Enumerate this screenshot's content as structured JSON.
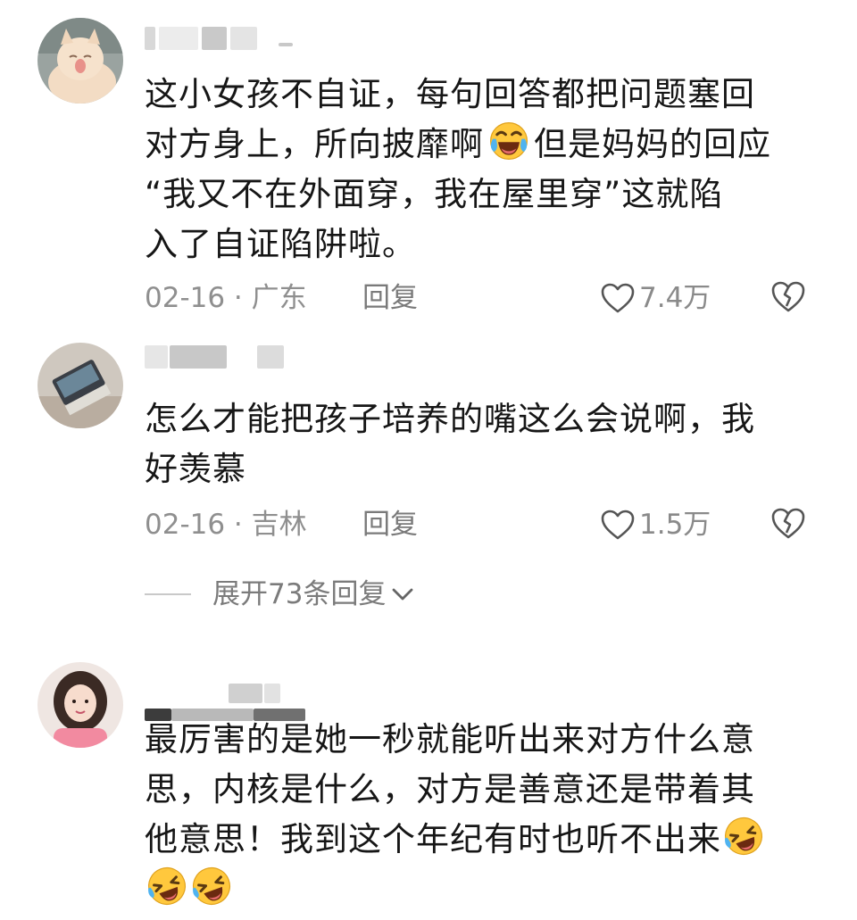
{
  "comments": [
    {
      "text_lines": [
        "这小女孩不自证，每句回答都把问题塞回",
        "对方身上，所向披靡啊",
        "但是妈妈的回应",
        "“我又不在外面穿，我在屋里穿”这就陷",
        "入了自证陷阱啦。"
      ],
      "date": "02-16",
      "region": "广东",
      "date_region": "02-16 · 广东",
      "reply_label": "回复",
      "likes": "7.4万"
    },
    {
      "text_lines": [
        "怎么才能把孩子培养的嘴这么会说啊，我",
        "好羡慕"
      ],
      "date_region": "02-16 · 吉林",
      "reply_label": "回复",
      "likes": "1.5万"
    },
    {
      "text_lines": [
        "最厉害的是她一秒就能听出来对方什么意",
        "思，内核是什么，对方是善意还是带着其",
        "他意思！我到这个年纪有时也听不出来"
      ]
    }
  ],
  "expand_replies": "展开73条回复",
  "icons": {
    "like": "heart-outline-icon",
    "dislike": "broken-heart-icon",
    "expand": "chevron-down-icon",
    "emoji_tears": "tears-of-joy-emoji",
    "emoji_rofl": "rolling-laughing-emoji"
  }
}
